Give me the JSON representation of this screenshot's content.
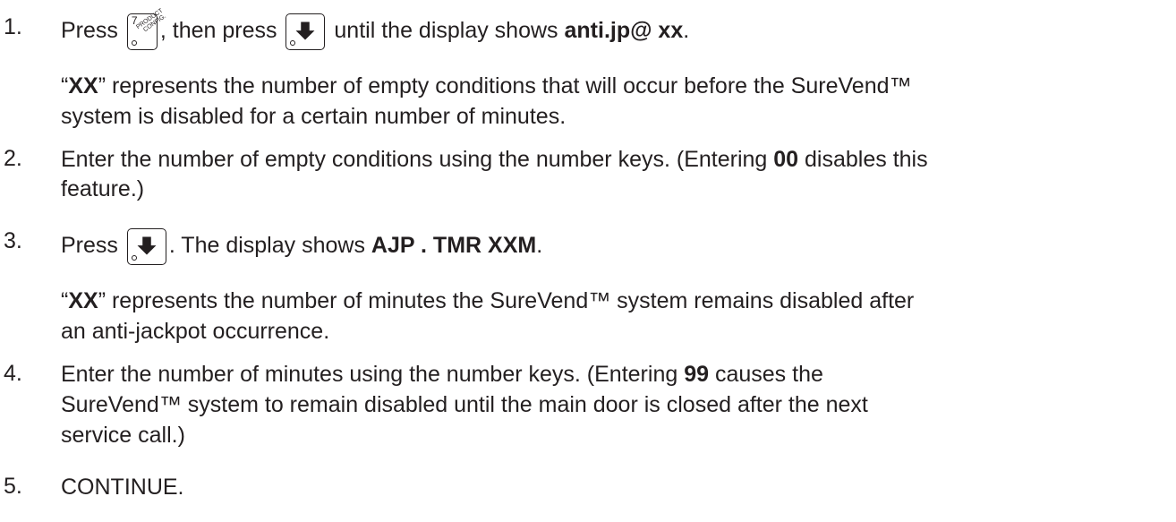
{
  "keys": {
    "product_config": {
      "digit": "7",
      "line1": "PRODUCT",
      "line2": "CONFIG."
    }
  },
  "steps": [
    {
      "number": "1.",
      "press": "Press",
      "then_press": ", then press",
      "until": "until the display shows",
      "display": "anti.jp@ xx",
      "end": ".",
      "note_quote_open": "“",
      "note_code": "XX",
      "note_line1": "” represents the number of empty conditions that will occur before the SureVend™",
      "note_line2": "system is disabled for a certain number of minutes."
    },
    {
      "number": "2.",
      "line1_before": "Enter the number of empty conditions using the number keys.  (Entering ",
      "code": "00",
      "line1_after": " disables this",
      "line2": "feature.)"
    },
    {
      "number": "3.",
      "press": "Press",
      "after_key": ".  The display shows ",
      "display": "AJP . TMR XXM",
      "end": ".",
      "note_quote_open": "“",
      "note_code": "XX",
      "note_line1": "” represents the number of minutes the SureVend™ system remains disabled after",
      "note_line2": "an anti-jackpot occurrence."
    },
    {
      "number": "4.",
      "line1_before": "Enter the number of minutes using the number keys.  (Entering ",
      "code": "99",
      "line1_after": " causes the",
      "line2": "SureVend™ system to remain disabled until the main door is closed after the next",
      "line3": "service call.)"
    },
    {
      "number": "5.",
      "text": "CONTINUE."
    }
  ]
}
